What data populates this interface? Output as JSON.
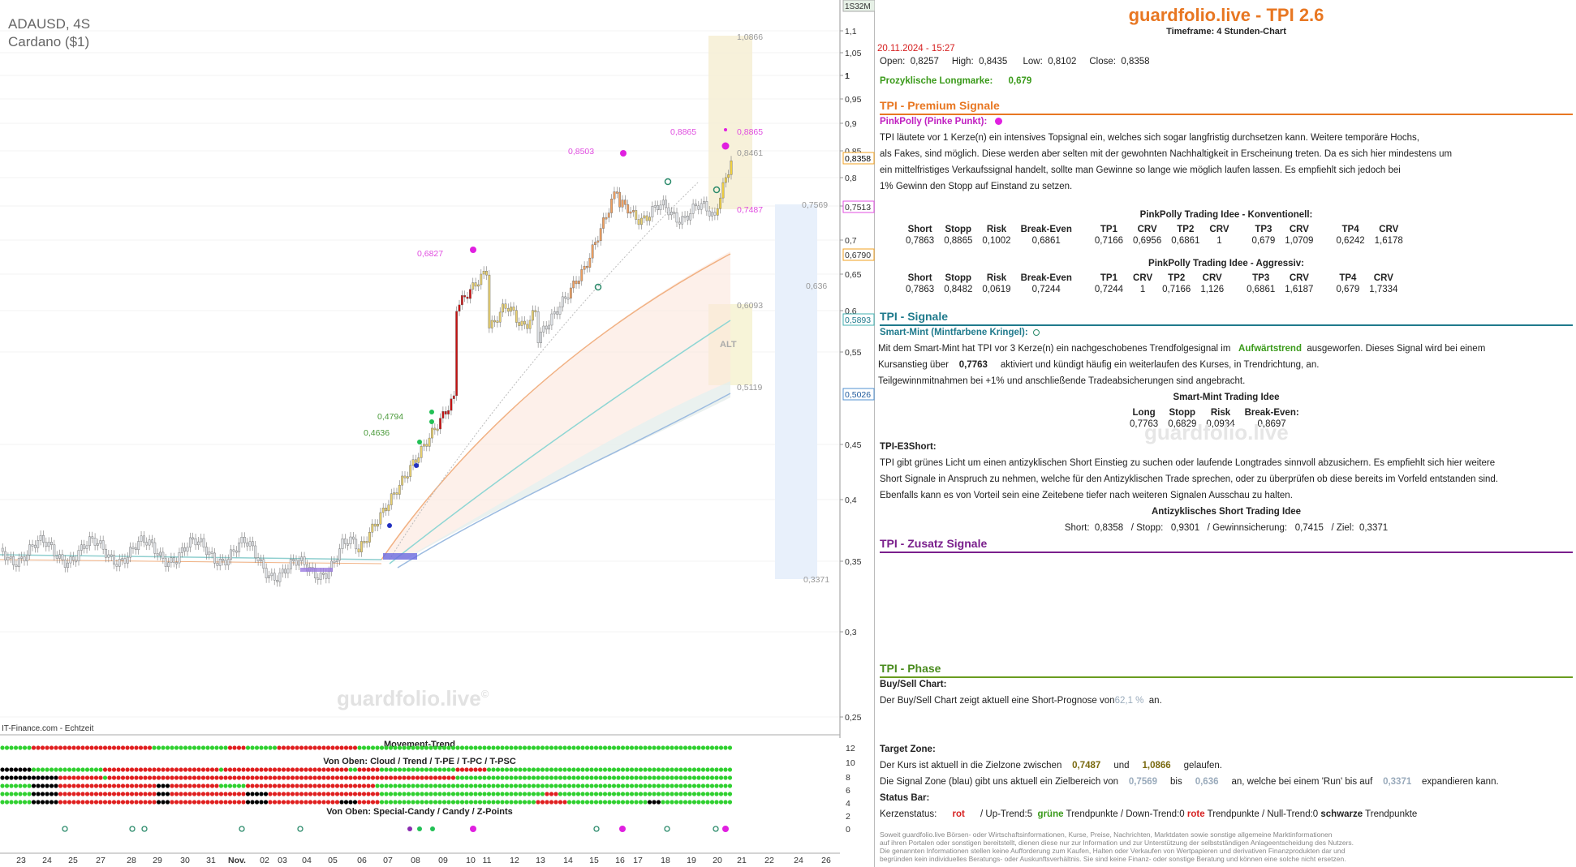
{
  "chart": {
    "symbol": "ADAUSD, 4S",
    "name": "Cardano ($1)",
    "source": "IT-Finance.com - Echtzeit",
    "watermark": "guardfolio.live",
    "watermark_mark": "©",
    "volume_label": "1S32M",
    "price_axis": [
      "1,1",
      "1,05",
      "1",
      "0,95",
      "0,9",
      "0,85",
      "0,8",
      "0,75",
      "0,7",
      "0,65",
      "0,6",
      "0,55",
      "0,45",
      "0,4",
      "0,35",
      "0,3",
      "0,25"
    ],
    "price_tags": {
      "current": "0,8358",
      "t1": "0,7513",
      "t2": "0,6790",
      "t3": "0,5893",
      "t4": "0,5026"
    },
    "level_labels": {
      "zone_top": "1,0866",
      "zone_pink_upper": "0,8865",
      "zone_8461": "0,8461",
      "zone_7487": "0,7487",
      "blue_top": "0,7569",
      "blue_mid": "0,636",
      "blue_bottom": "0,3371",
      "alt_top": "0,6093",
      "alt_bottom": "0,5119",
      "alt_text": "ALT"
    },
    "signal_labels": {
      "s8503": "0,8503",
      "s8865": "0,8865",
      "s6827": "0,6827",
      "s4794": "0,4794",
      "s4636": "0,4636"
    },
    "x_axis": [
      "23",
      "24",
      "25",
      "27",
      "28",
      "29",
      "30",
      "31",
      "Nov.",
      "02",
      "03",
      "04",
      "05",
      "06",
      "07",
      "08",
      "09",
      "10",
      "11",
      "12",
      "13",
      "14",
      "15",
      "16",
      "17",
      "18",
      "19",
      "20",
      "21",
      "22",
      "24",
      "26"
    ],
    "sub": {
      "title1": "Movement-Trend",
      "title2": "Von Oben: Cloud / Trend / T-PE / T-PC / T-PSC",
      "title3": "Von Oben: Special-Candy / Candy / Z-Points",
      "axis": [
        "12",
        "10",
        "8",
        "6",
        "4",
        "2",
        "0"
      ]
    }
  },
  "info": {
    "brand": "guardfolio.live - TPI 2.6",
    "timeframe": "Timeframe: 4 Stunden-Chart",
    "datetime": "20.11.2024 - 15:27",
    "ohlc": {
      "open_label": "Open:",
      "open": "0,8257",
      "high_label": "High:",
      "high": "0,8435",
      "low_label": "Low:",
      "low": "0,8102",
      "close_label": "Close:",
      "close": "0,8358"
    },
    "prozyk_label": "Prozyklische Longmarke:",
    "prozyk_value": "0,679",
    "premium": {
      "title": "TPI - Premium Signale",
      "pp_label": "PinkPolly (Pinke Punkt):",
      "text": [
        "TPI läutete vor 1  Kerze(n) ein intensives Topsignal ein, welches sich sogar langfristig durchsetzen kann. Weitere temporäre Hochs,",
        "als Fakes, sind möglich. Diese werden aber selten mit der gewohnten Nachhaltigkeit in Erscheinung treten. Da es sich hier mindestens um",
        "ein mittelfristiges Verkaufssignal handelt, sollte man Gewinne so lange wie möglich laufen lassen. Es empfiehlt sich jedoch bei",
        " 1% Gewinn den Stopp auf Einstand zu setzen."
      ],
      "konv_title": "PinkPolly Trading Idee - Konventionell:",
      "agg_title": "PinkPolly Trading Idee - Aggressiv:",
      "headers": [
        "Short",
        "Stopp",
        "Risk",
        "Break-Even",
        "TP1",
        "CRV",
        "TP2",
        "CRV",
        "TP3",
        "CRV",
        "TP4",
        "CRV"
      ],
      "konv": [
        "0,7863",
        "0,8865",
        "0,1002",
        "0,6861",
        "0,7166",
        "0,6956",
        "0,6861",
        "1",
        "0,679",
        "1,0709",
        "0,6242",
        "1,6178"
      ],
      "agg": [
        "0,7863",
        "0,8482",
        "0,0619",
        "0,7244",
        "0,7244",
        "1",
        "0,7166",
        "1,126",
        "0,6861",
        "1,6187",
        "0,679",
        "1,7334"
      ]
    },
    "signale": {
      "title": "TPI - Signale",
      "mint_label": "Smart-Mint (Mintfarbene Kringel):",
      "mint_line1_a": "Mit dem Smart-Mint hat TPI vor 3  Kerze(n) ein nachgeschobenes Trendfolgesignal im",
      "mint_line1_b": "Aufwärtstrend",
      "mint_line1_c": "ausgeworfen. Dieses Signal wird bei einem",
      "mint_line2_a": "Kursanstieg über",
      "mint_line2_b": "0,7763",
      "mint_line2_c": "aktiviert und kündigt häufig ein weiterlaufen des Kurses, in Trendrichtung, an.",
      "mint_line3": "Teilgewinnmitnahmen bei +1% und anschließende Tradeabsicherungen sind angebracht.",
      "mint_idea_title": "Smart-Mint Trading Idee",
      "mint_headers": [
        "Long",
        "Stopp",
        "Risk",
        "Break-Even:"
      ],
      "mint_values": [
        "0,7763",
        "0,6829",
        "0,0934",
        "0,8697"
      ],
      "e3_label": "TPI-E3Short:",
      "e3_text": [
        "TPI gibt grünes Licht um einen antizyklischen Short Einstieg zu suchen oder laufende Longtrades sinnvoll abzusichern. Es empfiehlt sich hier weitere",
        "Short Signale in Anspruch zu nehmen, welche für den Antizyklischen Trade sprechen, oder zu überprüfen ob diese bereits im Vorfeld entstanden sind.",
        "Ebenfalls kann es von Vorteil sein eine Zeitebene tiefer nach weiteren Signalen Ausschau zu halten."
      ],
      "e3_idea_title": "Antizyklisches Short Trading Idee",
      "e3_line": "Short:  0,8358   / Stopp:   0,9301   / Gewinnsicherung:   0,7415   / Ziel:  0,3371"
    },
    "zusatz": {
      "title": "TPI - Zusatz Signale"
    },
    "phase": {
      "title": "TPI - Phase",
      "bs_label": "Buy/Sell Chart:",
      "bs_text_a": "Der Buy/Sell Chart zeigt aktuell eine Short-Prognose von",
      "bs_value": "62,1 %",
      "bs_text_b": "an.",
      "tz_label": "Target Zone:",
      "tz_a": "Der Kurs ist aktuell in die Zielzone zwischen",
      "tz_v1": "0,7487",
      "tz_und": "und",
      "tz_v2": "1,0866",
      "tz_b": "gelaufen.",
      "sz_a": "Die Signal Zone (blau) gibt uns aktuell ein Zielbereich von",
      "sz_v1": "0,7569",
      "sz_bis": "bis",
      "sz_v2": "0,636",
      "sz_b": "an, welche bei einem 'Run' bis auf",
      "sz_v3": "0,3371",
      "sz_c": "expandieren kann.",
      "sb_label": "Status Bar:",
      "sb_a": "Kerzenstatus:",
      "sb_rot": "rot",
      "sb_b": "/ Up-Trend:5",
      "sb_gruene": "grüne",
      "sb_c": "Trendpunkte  / Down-Trend:0",
      "sb_rote": "rote",
      "sb_d": "Trendpunkte  / Null-Trend:0",
      "sb_schwarze": "schwarze",
      "sb_e": "Trendpunkte"
    },
    "watermark": "guardfolio.live",
    "disclaimer": [
      "Soweit guardfolio.live Börsen- oder Wirtschaftsinformationen, Kurse, Preise, Nachrichten, Marktdaten sowie sonstige allgemeine Marktinformationen",
      "auf ihren Portalen oder sonstigen bereitstellt, dienen diese nur zur Information und zur Unterstützung der selbstständigen Anlageentscheidung des Nutzers.",
      "Die genannten Informationen stellen keine Aufforderung zum Kaufen, Halten oder Verkaufen von Wertpapieren und derivativen Finanzprodukten dar und",
      "begründen kein individuelles Beratungs- oder Auskunftsverhältnis. Sie sind keine Finanz- oder sonstige Beratung und können eine solche nicht ersetzen."
    ]
  }
}
